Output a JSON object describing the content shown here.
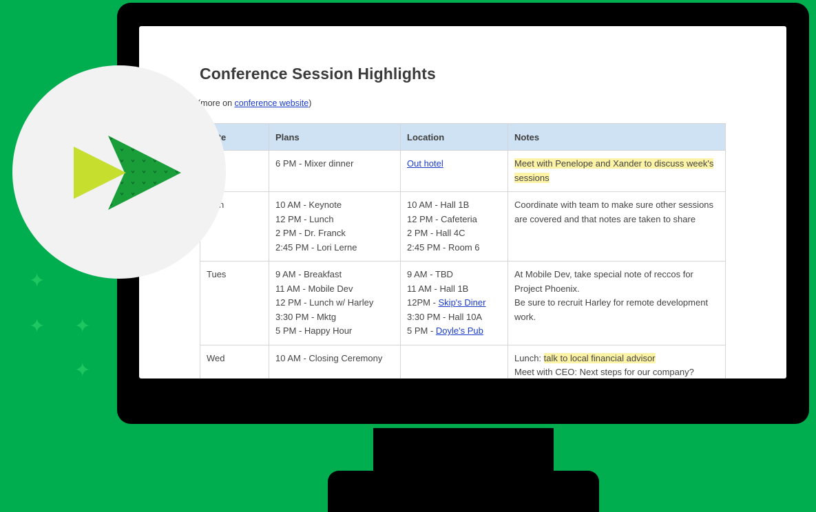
{
  "document": {
    "title": "Conference Session Highlights",
    "subtitle_prefix": "(more on ",
    "subtitle_link": "conference website",
    "subtitle_suffix": ")"
  },
  "table": {
    "headers": [
      "Date",
      "Plans",
      "Location",
      "Notes"
    ],
    "rows": [
      {
        "day": "",
        "plans": [
          "6 PM - Mixer dinner"
        ],
        "location": [
          {
            "text": "Out hotel",
            "link": true
          }
        ],
        "notes": [
          {
            "text": "Meet with Penelope and Xander to discuss week's sessions",
            "highlight": true
          }
        ]
      },
      {
        "day": "Mon",
        "plans": [
          "10 AM - Keynote",
          "12 PM - Lunch",
          "2 PM - Dr. Franck",
          "2:45 PM - Lori Lerne"
        ],
        "location": [
          {
            "text": "10 AM - Hall 1B"
          },
          {
            "text": "12 PM - Cafeteria"
          },
          {
            "text": "2 PM - Hall 4C"
          },
          {
            "text": "2:45 PM - Room 6"
          }
        ],
        "notes": [
          {
            "text": "Coordinate with team to make sure other sessions are covered and that notes are taken to share"
          }
        ]
      },
      {
        "day": "Tues",
        "plans": [
          "9 AM - Breakfast",
          "11 AM - Mobile Dev",
          "12 PM - Lunch w/ Harley",
          "3:30 PM - Mktg",
          "5 PM - Happy Hour"
        ],
        "location": [
          {
            "text": "9 AM - TBD"
          },
          {
            "text": "11 AM - Hall 1B"
          },
          {
            "prefix": "12PM - ",
            "text": "Skip's Diner",
            "link": true
          },
          {
            "text": "3:30 PM - Hall 10A"
          },
          {
            "prefix": "5 PM - ",
            "text": "Doyle's Pub",
            "link": true
          }
        ],
        "notes": [
          {
            "text": "At Mobile Dev, take special note of reccos for Project Phoenix."
          },
          {
            "text": "Be sure to recruit Harley for remote development work."
          }
        ]
      },
      {
        "day": "Wed",
        "plans": [
          "10 AM - Closing Ceremony"
        ],
        "location": [],
        "notes": [
          {
            "prefix": "Lunch: ",
            "text": "talk to local financial advisor",
            "highlight": true
          },
          {
            "text": "Meet with CEO: Next steps for our company?"
          }
        ]
      }
    ]
  },
  "colors": {
    "background": "#00ae4f",
    "header_fill": "#cfe2f3",
    "highlight": "#fdf3a6",
    "link": "#1a3cc8",
    "logo_front": "#c6de2e",
    "logo_back": "#1a9e3a"
  },
  "logo": {
    "icon": "play-arrows-logo-icon"
  }
}
